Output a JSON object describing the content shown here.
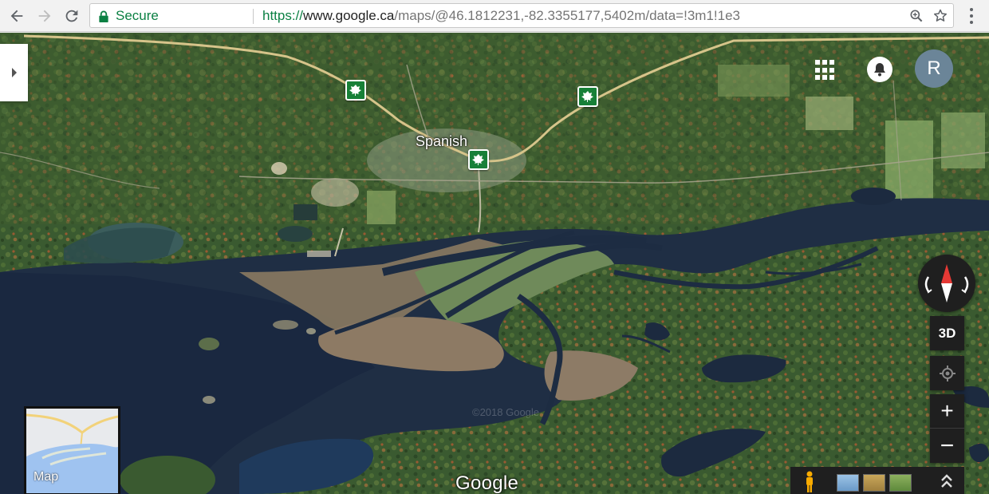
{
  "browser": {
    "secure_label": "Secure",
    "url_scheme": "https://",
    "url_host": "www.google.ca",
    "url_path": "/maps/@46.1812231,-82.3355177,5402m/data=!3m1!1e3",
    "icons": [
      "back-icon",
      "forward-icon",
      "reload-icon",
      "lock-icon",
      "zoom-icon",
      "bookmark-star-icon",
      "menu-icon"
    ]
  },
  "map": {
    "place_label": "Spanish",
    "account_initial": "R",
    "view_3d_label": "3D",
    "zoom_in_label": "+",
    "zoom_out_label": "−",
    "minimap_label": "Map",
    "logo_text": "Google",
    "watermark": "©2018 Google",
    "accent_colors": {
      "secure_green": "#0b8043",
      "route_shield": "#188038",
      "compass_red": "#e53935",
      "avatar": "#6b8598"
    }
  }
}
